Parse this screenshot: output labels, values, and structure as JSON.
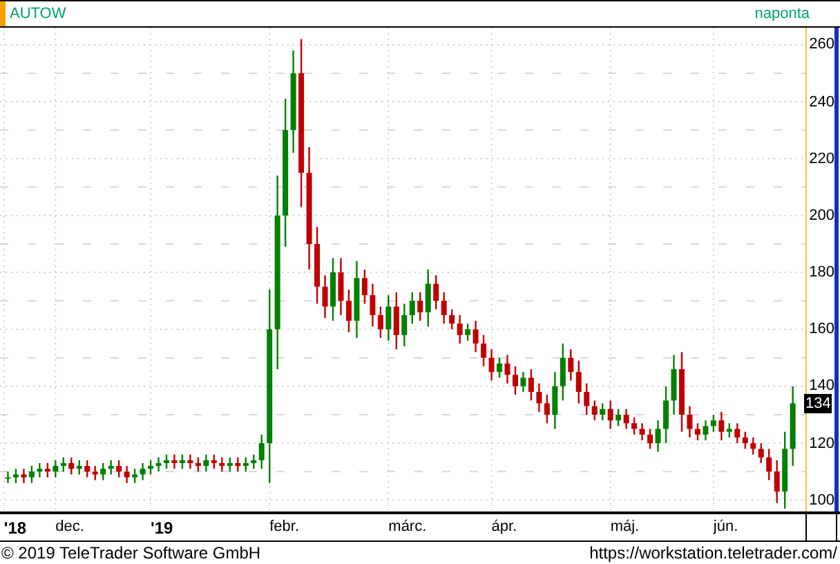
{
  "header": {
    "symbol": "AUTOW",
    "interval": "naponta"
  },
  "chart": {
    "last_price": "134",
    "x_axis_labels": [
      "'18",
      "dec.",
      "'19",
      "febr.",
      "márc.",
      "ápr.",
      "máj.",
      "jún."
    ],
    "chart_data": {
      "type": "candlestick",
      "grid": true,
      "ylim": [
        96,
        266
      ],
      "yticks": [
        {
          "value": 100,
          "label": "100"
        },
        {
          "value": 120,
          "label": "120"
        },
        {
          "value": 140,
          "label": "140"
        },
        {
          "value": 160,
          "label": "160"
        },
        {
          "value": 180,
          "label": "180"
        },
        {
          "value": 200,
          "label": "200"
        },
        {
          "value": 220,
          "label": "220"
        },
        {
          "value": 240,
          "label": "240"
        },
        {
          "value": 260,
          "label": "260"
        }
      ],
      "categories": [
        null,
        null,
        null,
        null,
        null,
        null,
        null,
        null,
        null,
        null,
        null,
        null,
        null,
        null,
        null,
        null,
        null,
        null,
        null,
        null,
        null,
        null,
        null,
        null,
        null,
        null,
        null,
        null,
        null,
        null,
        null,
        null,
        null,
        null,
        null,
        null,
        null,
        null,
        null,
        null,
        null,
        null,
        null,
        null,
        null,
        null,
        null,
        null,
        null,
        null,
        null,
        null,
        null,
        null,
        null,
        null,
        null,
        null,
        null,
        null,
        null,
        null,
        null,
        null,
        null,
        null,
        null,
        null,
        null,
        null,
        null,
        null,
        null,
        null,
        null,
        null,
        null,
        null,
        null,
        null,
        null,
        null,
        null,
        null,
        null,
        null,
        null,
        null,
        null,
        null,
        null,
        null,
        null,
        null,
        null,
        null,
        null,
        null,
        null,
        null
      ],
      "ohlc": [
        [
          108,
          110,
          106,
          108
        ],
        [
          108,
          111,
          106,
          109
        ],
        [
          109,
          111,
          106,
          108
        ],
        [
          108,
          112,
          106,
          110
        ],
        [
          110,
          113,
          108,
          111
        ],
        [
          111,
          113,
          108,
          110
        ],
        [
          110,
          114,
          108,
          112
        ],
        [
          112,
          115,
          110,
          113
        ],
        [
          113,
          115,
          109,
          111
        ],
        [
          111,
          114,
          109,
          112
        ],
        [
          112,
          114,
          108,
          110
        ],
        [
          110,
          112,
          107,
          109
        ],
        [
          109,
          113,
          107,
          111
        ],
        [
          111,
          114,
          109,
          112
        ],
        [
          112,
          114,
          108,
          110
        ],
        [
          110,
          112,
          106,
          108
        ],
        [
          108,
          111,
          106,
          109
        ],
        [
          109,
          113,
          107,
          111
        ],
        [
          111,
          114,
          109,
          112
        ],
        [
          112,
          115,
          110,
          113
        ],
        [
          113,
          116,
          111,
          114
        ],
        [
          114,
          116,
          111,
          113
        ],
        [
          113,
          116,
          111,
          114
        ],
        [
          114,
          116,
          111,
          113
        ],
        [
          113,
          115,
          110,
          112
        ],
        [
          112,
          116,
          110,
          114
        ],
        [
          114,
          116,
          111,
          113
        ],
        [
          113,
          115,
          110,
          112
        ],
        [
          112,
          115,
          110,
          113
        ],
        [
          113,
          115,
          110,
          112
        ],
        [
          112,
          115,
          110,
          113
        ],
        [
          113,
          116,
          111,
          114
        ],
        [
          114,
          123,
          111,
          120
        ],
        [
          120,
          174,
          106,
          160
        ],
        [
          160,
          214,
          146,
          200
        ],
        [
          200,
          241,
          189,
          230
        ],
        [
          230,
          258,
          222,
          250
        ],
        [
          250,
          262,
          203,
          215
        ],
        [
          215,
          224,
          181,
          190
        ],
        [
          190,
          196,
          169,
          175
        ],
        [
          175,
          179,
          164,
          168
        ],
        [
          168,
          185,
          163,
          180
        ],
        [
          180,
          185,
          165,
          170
        ],
        [
          170,
          174,
          159,
          163
        ],
        [
          163,
          184,
          157,
          178
        ],
        [
          178,
          181,
          169,
          172
        ],
        [
          172,
          176,
          161,
          165
        ],
        [
          165,
          168,
          157,
          160
        ],
        [
          160,
          172,
          156,
          168
        ],
        [
          168,
          173,
          153,
          158
        ],
        [
          158,
          169,
          154,
          165
        ],
        [
          165,
          173,
          162,
          170
        ],
        [
          170,
          173,
          163,
          166
        ],
        [
          166,
          181,
          161,
          176
        ],
        [
          176,
          179,
          167,
          170
        ],
        [
          170,
          173,
          162,
          165
        ],
        [
          165,
          167,
          160,
          162
        ],
        [
          162,
          165,
          155,
          158
        ],
        [
          158,
          162,
          156,
          160
        ],
        [
          160,
          163,
          152,
          155
        ],
        [
          155,
          158,
          147,
          150
        ],
        [
          150,
          153,
          142,
          145
        ],
        [
          145,
          150,
          143,
          148
        ],
        [
          148,
          151,
          141,
          144
        ],
        [
          144,
          147,
          137,
          140
        ],
        [
          140,
          145,
          138,
          143
        ],
        [
          143,
          146,
          135,
          138
        ],
        [
          138,
          141,
          131,
          134
        ],
        [
          134,
          137,
          127,
          130
        ],
        [
          130,
          145,
          125,
          140
        ],
        [
          140,
          155,
          135,
          150
        ],
        [
          150,
          153,
          142,
          145
        ],
        [
          145,
          149,
          134,
          138
        ],
        [
          138,
          141,
          130,
          133
        ],
        [
          133,
          135,
          128,
          130
        ],
        [
          130,
          134,
          128,
          132
        ],
        [
          132,
          135,
          125,
          128
        ],
        [
          128,
          132,
          126,
          130
        ],
        [
          130,
          132,
          125,
          127
        ],
        [
          127,
          129,
          123,
          125
        ],
        [
          125,
          127,
          121,
          123
        ],
        [
          123,
          125,
          118,
          120
        ],
        [
          120,
          128,
          117,
          125
        ],
        [
          125,
          140,
          120,
          135
        ],
        [
          135,
          151,
          130,
          146
        ],
        [
          146,
          152,
          124,
          130
        ],
        [
          130,
          133,
          122,
          125
        ],
        [
          125,
          127,
          121,
          123
        ],
        [
          123,
          128,
          121,
          126
        ],
        [
          126,
          130,
          124,
          128
        ],
        [
          128,
          131,
          121,
          124
        ],
        [
          124,
          127,
          122,
          125
        ],
        [
          125,
          127,
          120,
          122
        ],
        [
          122,
          124,
          118,
          120
        ],
        [
          120,
          122,
          116,
          118
        ],
        [
          118,
          120,
          113,
          115
        ],
        [
          115,
          118,
          107,
          110
        ],
        [
          110,
          114,
          99,
          103
        ],
        [
          103,
          124,
          97,
          118
        ],
        [
          118,
          140,
          112,
          134
        ]
      ]
    }
  },
  "footer": {
    "copyright": "© 2019 TeleTrader Software GmbH",
    "url": "https://workstation.teletrader.com/"
  }
}
